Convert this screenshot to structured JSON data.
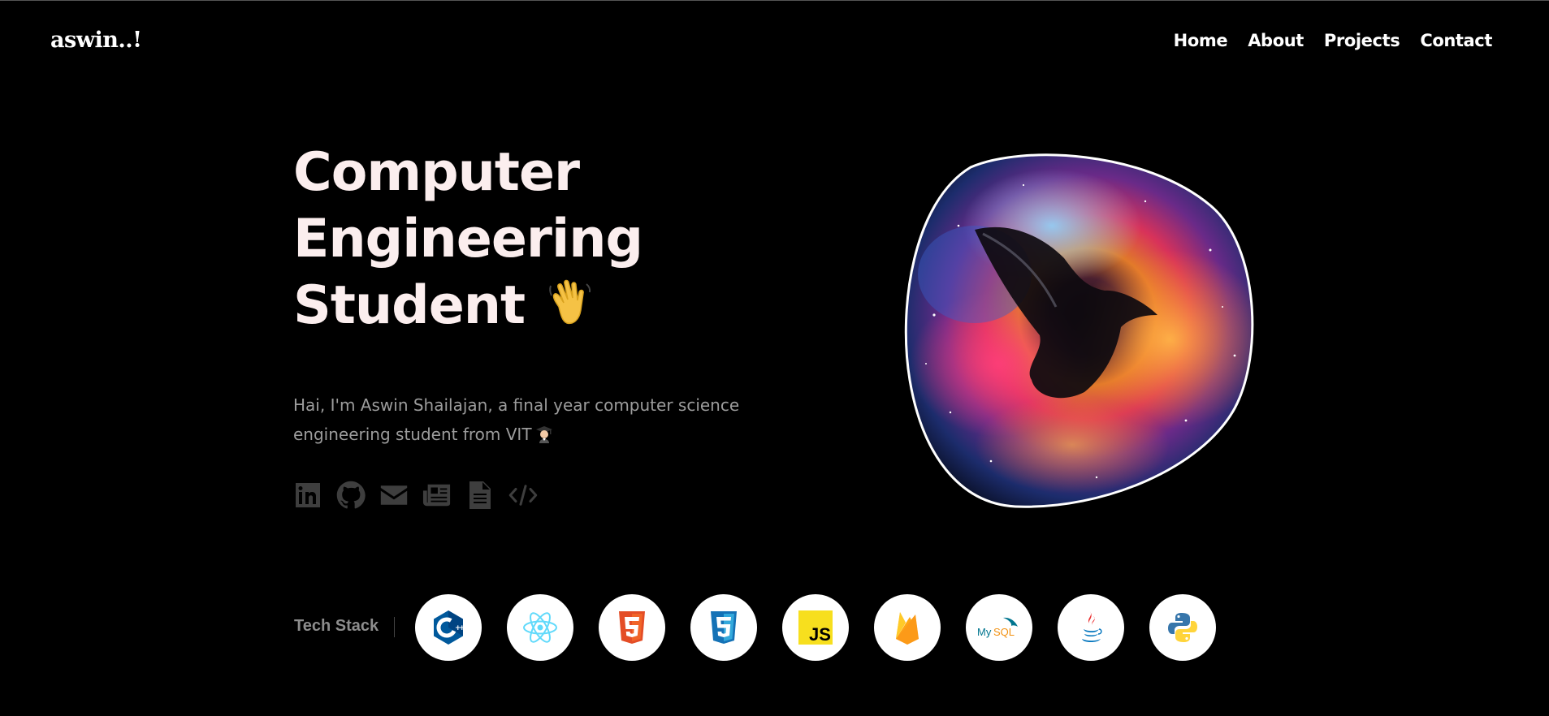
{
  "header": {
    "logo": "aswin..!",
    "nav": [
      {
        "label": "Home"
      },
      {
        "label": "About"
      },
      {
        "label": "Projects"
      },
      {
        "label": "Contact"
      }
    ]
  },
  "hero": {
    "title_lines": [
      "Computer",
      "Engineering",
      "Student"
    ],
    "title_emoji": "waving-hand-icon",
    "intro": "Hai, I'm Aswin Shailajan, a final year computer science engineering student from VIT",
    "intro_emoji": "graduate-icon",
    "socials": [
      "linkedin-icon",
      "github-icon",
      "email-icon",
      "blog-icon",
      "resume-icon",
      "code-icon"
    ],
    "image": "nebula-bird"
  },
  "tech_stack": {
    "label": "Tech Stack",
    "items": [
      "c++-icon",
      "react-icon",
      "html5-icon",
      "css3-icon",
      "javascript-icon",
      "firebase-icon",
      "mysql-icon",
      "java-icon",
      "python-icon"
    ]
  },
  "colors": {
    "background": "#000000",
    "title": "#fbeeee",
    "intro_text": "#9c9c9c",
    "social_icons": "#3e3e3e"
  }
}
